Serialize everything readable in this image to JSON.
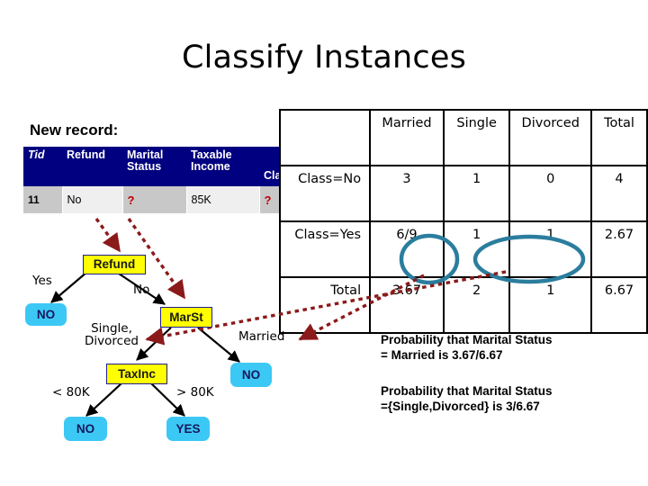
{
  "slide": {
    "title": "Classify Instances"
  },
  "new_record": {
    "label": "New record:",
    "columns": [
      "Tid",
      "Refund",
      "Marital Status",
      "Taxable Income",
      "Class"
    ],
    "row": [
      "11",
      "No",
      "?",
      "85K",
      "?"
    ],
    "header_color": "#000080",
    "unknown_marker_color": "#c00000"
  },
  "contingency_table": {
    "corner": "",
    "columns": [
      "Married",
      "Single",
      "Divorced",
      "Total"
    ],
    "rows": [
      {
        "label": "Class=No",
        "cells": [
          "3",
          "1",
          "0",
          "4"
        ]
      },
      {
        "label": "Class=Yes",
        "cells": [
          "6/9",
          "1",
          "1",
          "2.67"
        ]
      },
      {
        "label": "Total",
        "cells": [
          "3.67",
          "2",
          "1",
          "6.67"
        ]
      }
    ],
    "highlight_color": "#2b7d9e",
    "highlights": [
      "3.67",
      "2",
      "1"
    ]
  },
  "decision_tree": {
    "nodes": [
      {
        "name": "refund",
        "label": "Refund",
        "kind": "attribute"
      },
      {
        "name": "marst",
        "label": "MarSt",
        "kind": "attribute"
      },
      {
        "name": "taxinc",
        "label": "TaxInc",
        "kind": "attribute"
      },
      {
        "name": "leaf-refund-yes",
        "label": "NO",
        "kind": "leaf"
      },
      {
        "name": "leaf-married",
        "label": "NO",
        "kind": "leaf"
      },
      {
        "name": "leaf-lt80k",
        "label": "NO",
        "kind": "leaf"
      },
      {
        "name": "leaf-gt80k",
        "label": "YES",
        "kind": "leaf"
      }
    ],
    "edge_labels": {
      "yes": "Yes",
      "no": "No",
      "single_divorced": "Single, Divorced",
      "married": "Married",
      "lt_80k": "< 80K",
      "gt_80k": "> 80K"
    },
    "attribute_fill": "#ffff00",
    "leaf_fill": "#3cc8f5",
    "arrow_color": "#8b1a1a"
  },
  "annotations": {
    "probability_married": "Probability that Marital Status = Married is 3.67/6.67",
    "probability_married_line1": "Probability that Marital Status",
    "probability_married_line2": "= Married is 3.67/6.67",
    "probability_single_divorced": "Probability that Marital Status ={Single,Divorced} is 3/6.67",
    "probability_single_divorced_line1": "Probability that Marital Status",
    "probability_single_divorced_line2": "={Single,Divorced} is 3/6.67"
  }
}
